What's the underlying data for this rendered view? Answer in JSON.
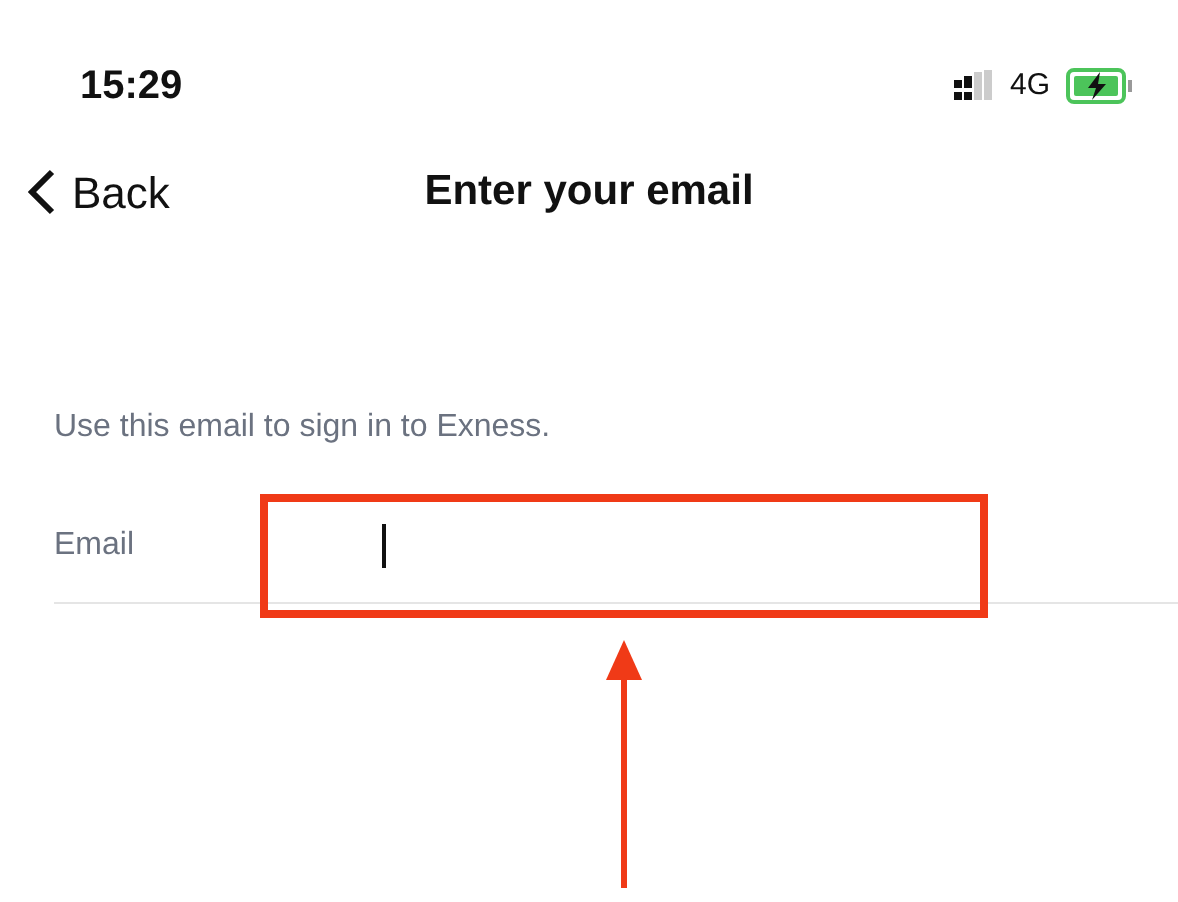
{
  "status_bar": {
    "time": "15:29",
    "network": "4G"
  },
  "nav_bar": {
    "back": "Back",
    "title": "Enter your email"
  },
  "hint": "Use this email to sign in to Exness.",
  "email_field": {
    "label": "Email",
    "focused": true
  },
  "annotations": {
    "highlight_box": true,
    "pointer_arrow": true
  }
}
